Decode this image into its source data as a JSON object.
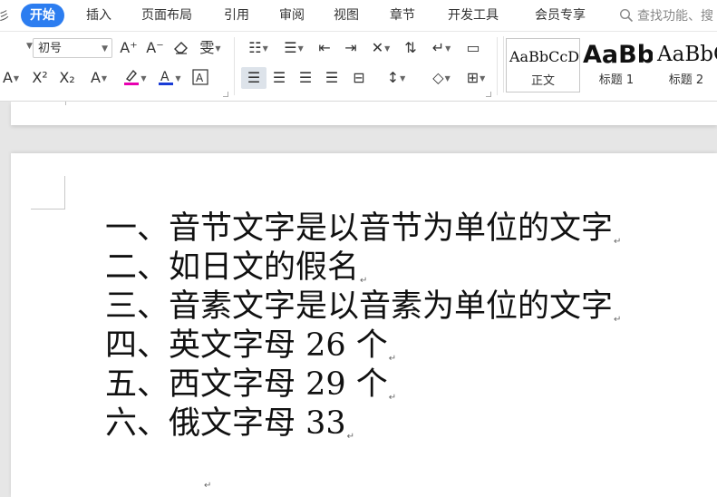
{
  "menubar": {
    "left_fragment": "开",
    "tabs": [
      {
        "label": "开始",
        "active": true
      },
      {
        "label": "插入"
      },
      {
        "label": "页面布局"
      },
      {
        "label": "引用"
      },
      {
        "label": "审阅"
      },
      {
        "label": "视图"
      },
      {
        "label": "章节"
      },
      {
        "label": "开发工具"
      },
      {
        "label": "会员专享"
      }
    ],
    "search_text": "查找功能、搜"
  },
  "ribbon": {
    "font_size_value": "初号",
    "styles": [
      {
        "sample": "AaBbCcDd",
        "name": "正文"
      },
      {
        "sample": "AaBb",
        "name": "标题 1"
      },
      {
        "sample": "AaBbC",
        "name": "标题 2"
      }
    ],
    "colors": {
      "highlight": "#e800b0",
      "font_color": "#1a3cd6",
      "accent": "#2c7df0"
    }
  },
  "document": {
    "lines": [
      "一、音节文字是以音节为单位的文字",
      "二、如日文的假名",
      "三、音素文字是以音素为单位的文字",
      "四、英文字母 26 个",
      "五、西文字母 29 个",
      "六、俄文字母 33"
    ],
    "paragraph_mark": "↵"
  }
}
